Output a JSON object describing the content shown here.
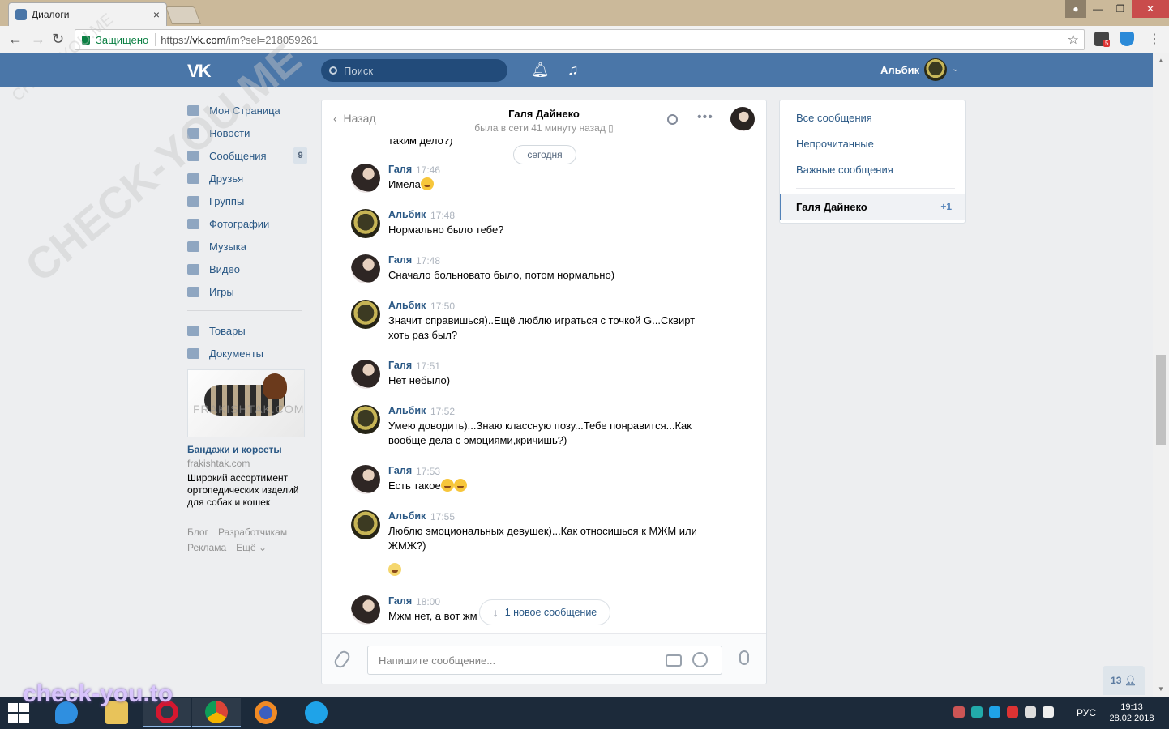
{
  "browser": {
    "tab_title": "Диалоги",
    "tab_close": "×",
    "secure_label": "Защищено",
    "url_scheme": "https://",
    "url_host": "vk.com",
    "url_path": "/im?sel=218059261",
    "ext_badge": "5"
  },
  "header": {
    "logo": "VK",
    "search_placeholder": "Поиск",
    "user_name": "Альбик"
  },
  "left_menu": {
    "items": [
      {
        "label": "Моя Страница",
        "icon": "home-icon"
      },
      {
        "label": "Новости",
        "icon": "news-icon"
      },
      {
        "label": "Сообщения",
        "icon": "messages-icon",
        "badge": "9"
      },
      {
        "label": "Друзья",
        "icon": "friends-icon"
      },
      {
        "label": "Группы",
        "icon": "groups-icon"
      },
      {
        "label": "Фотографии",
        "icon": "photos-icon"
      },
      {
        "label": "Музыка",
        "icon": "music-icon"
      },
      {
        "label": "Видео",
        "icon": "video-icon"
      },
      {
        "label": "Игры",
        "icon": "games-icon"
      }
    ],
    "items2": [
      {
        "label": "Товары",
        "icon": "market-icon"
      },
      {
        "label": "Документы",
        "icon": "docs-icon"
      }
    ]
  },
  "ad": {
    "watermark": "FRAKISHTAK.COM",
    "title": "Бандажи и корсеты",
    "domain": "frakishtak.com",
    "text": "Широкий ассортимент ортопедических изделий для собак и кошек"
  },
  "footer": {
    "blog": "Блог",
    "devs": "Разработчикам",
    "ads": "Реклама",
    "more": "Ещё ⌄"
  },
  "chat": {
    "back_label": "Назад",
    "contact_name": "Галя Дайнеко",
    "contact_status": "была в сети 41 минуту назад",
    "cut_text": "таким дело?)",
    "date_divider": "сегодня",
    "new_messages": "1 новое сообщение",
    "input_placeholder": "Напишите сообщение...",
    "messages": [
      {
        "author": "Галя",
        "time": "17:46",
        "text": "Имела"
      },
      {
        "author": "Альбик",
        "time": "17:48",
        "text": "Нормально было тебе?"
      },
      {
        "author": "Галя",
        "time": "17:48",
        "text": "Сначало больновато было, потом нормально)"
      },
      {
        "author": "Альбик",
        "time": "17:50",
        "text": "Значит справишься)..Ещё люблю играться с точкой G...Сквирт хоть раз был?"
      },
      {
        "author": "Галя",
        "time": "17:51",
        "text": "Нет небыло)"
      },
      {
        "author": "Альбик",
        "time": "17:52",
        "text": "Умею доводить)...Знаю классную позу...Тебе понравится...Как вообще дела с эмоциями,кричишь?)"
      },
      {
        "author": "Галя",
        "time": "17:53",
        "text": "Есть такое"
      },
      {
        "author": "Альбик",
        "time": "17:55",
        "text": "Люблю эмоциональных девушек)...Как относишься к МЖМ или ЖМЖ?)"
      },
      {
        "author": "Галя",
        "time": "18:00",
        "text": "Мжм нет, а вот жм"
      }
    ]
  },
  "folders": {
    "all": "Все сообщения",
    "unread": "Непрочитанные",
    "important": "Важные сообщения",
    "active_name": "Галя Дайнеко",
    "active_count": "+1"
  },
  "online_count": "13",
  "watermarks": {
    "diag": "CHECK-YOU.ME",
    "small": "CHECK-YOU.ME",
    "bottom": "check-you.to"
  },
  "taskbar": {
    "lang": "РУС",
    "time": "19:13",
    "date": "28.02.2018"
  }
}
